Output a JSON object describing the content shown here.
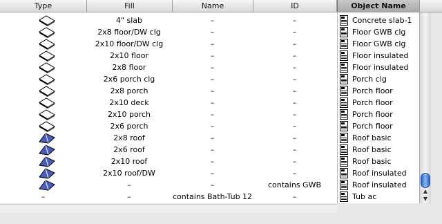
{
  "header": {
    "columns": [
      "Type",
      "Fill",
      "Name",
      "ID"
    ],
    "object_name": "Object Name"
  },
  "rows": [
    {
      "type_icon": "slab-icon",
      "fill": "4\" slab",
      "name": "–",
      "id": "–",
      "object": "Concrete slab-1"
    },
    {
      "type_icon": "slab-icon",
      "fill": "2x8 floor/DW clg",
      "name": "–",
      "id": "–",
      "object": "Floor GWB clg"
    },
    {
      "type_icon": "slab-icon",
      "fill": "2x10 floor/DW clg",
      "name": "–",
      "id": "–",
      "object": "Floor GWB clg"
    },
    {
      "type_icon": "slab-icon",
      "fill": "2x10 floor",
      "name": "–",
      "id": "–",
      "object": "Floor insulated"
    },
    {
      "type_icon": "slab-icon",
      "fill": "2x8 floor",
      "name": "–",
      "id": "–",
      "object": "Floor insulated"
    },
    {
      "type_icon": "slab-icon",
      "fill": "2x6 porch clg",
      "name": "–",
      "id": "–",
      "object": "Porch clg"
    },
    {
      "type_icon": "slab-icon",
      "fill": "2x8 porch",
      "name": "–",
      "id": "–",
      "object": "Porch floor"
    },
    {
      "type_icon": "slab-icon",
      "fill": "2x10 deck",
      "name": "–",
      "id": "–",
      "object": "Porch floor"
    },
    {
      "type_icon": "slab-icon",
      "fill": "2x10 porch",
      "name": "–",
      "id": "–",
      "object": "Porch floor"
    },
    {
      "type_icon": "slab-icon",
      "fill": "2x6 porch",
      "name": "–",
      "id": "–",
      "object": "Porch floor"
    },
    {
      "type_icon": "roof-icon",
      "fill": "2x8 roof",
      "name": "–",
      "id": "–",
      "object": "Roof basic"
    },
    {
      "type_icon": "roof-icon",
      "fill": "2x6 roof",
      "name": "–",
      "id": "–",
      "object": "Roof basic"
    },
    {
      "type_icon": "roof-icon",
      "fill": "2x10 roof",
      "name": "–",
      "id": "–",
      "object": "Roof basic"
    },
    {
      "type_icon": "roof-icon",
      "fill": "2x10 roof/DW",
      "name": "–",
      "id": "–",
      "object": "Roof insulated"
    },
    {
      "type_icon": "roof-icon",
      "fill": "–",
      "name": "–",
      "id": "contains GWB",
      "object": "Roof insulated"
    },
    {
      "type_icon": "",
      "type_text": "–",
      "fill": "–",
      "name": "contains Bath-Tub 12",
      "id": "–",
      "object": "Tub ac"
    }
  ],
  "colors": {
    "slab_top": "#ffffff",
    "roof_fill": "#4a5dbd",
    "scroll_thumb": "#2a63c7"
  }
}
